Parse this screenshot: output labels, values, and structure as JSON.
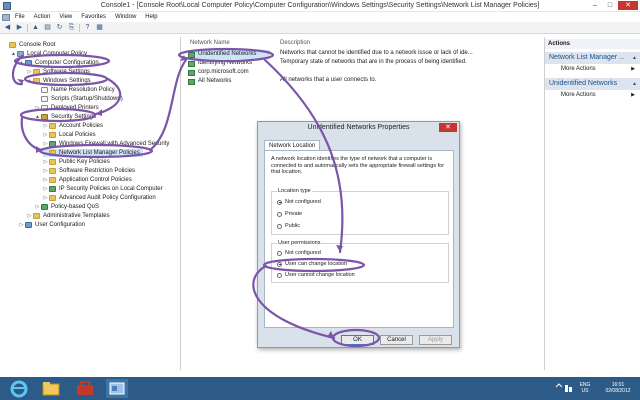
{
  "window": {
    "title": "Console1 - [Console Root\\Local Computer Policy\\Computer Configuration\\Windows Settings\\Security Settings\\Network List Manager Policies]",
    "minimize": "–",
    "maximize": "□",
    "close": "✕"
  },
  "menu": [
    "File",
    "Action",
    "View",
    "Favorites",
    "Window",
    "Help"
  ],
  "toolbar": {
    "back": "◀",
    "forward": "▶",
    "up": "▲",
    "show_hide": "▤",
    "refresh": "↻",
    "export": "⎘",
    "help": "?",
    "properties": "▦"
  },
  "tree": [
    {
      "label": "Console Root",
      "depth": 0,
      "expanded": "",
      "icon": "folder"
    },
    {
      "label": "Local Computer Policy",
      "depth": 1,
      "expanded": "▲",
      "icon": "gear"
    },
    {
      "label": "Computer Configuration",
      "depth": 2,
      "expanded": "▲",
      "icon": "comp"
    },
    {
      "label": "Software Settings",
      "depth": 3,
      "expanded": "▷",
      "icon": "folder"
    },
    {
      "label": "Windows Settings",
      "depth": 3,
      "expanded": "▲",
      "icon": "folder"
    },
    {
      "label": "Name Resolution Policy",
      "depth": 4,
      "expanded": "",
      "icon": "doc"
    },
    {
      "label": "Scripts (Startup/Shutdown)",
      "depth": 4,
      "expanded": "",
      "icon": "doc"
    },
    {
      "label": "Deployed Printers",
      "depth": 4,
      "expanded": "▷",
      "icon": "doc"
    },
    {
      "label": "Security Settings",
      "depth": 4,
      "expanded": "▲",
      "icon": "lock"
    },
    {
      "label": "Account Policies",
      "depth": 5,
      "expanded": "▷",
      "icon": "folder"
    },
    {
      "label": "Local Policies",
      "depth": 5,
      "expanded": "▷",
      "icon": "folder"
    },
    {
      "label": "Windows Firewall with Advanced Security",
      "depth": 5,
      "expanded": "▷",
      "icon": "net"
    },
    {
      "label": "Network List Manager Policies",
      "depth": 5,
      "expanded": "",
      "icon": "folder"
    },
    {
      "label": "Public Key Policies",
      "depth": 5,
      "expanded": "▷",
      "icon": "folder"
    },
    {
      "label": "Software Restriction Policies",
      "depth": 5,
      "expanded": "▷",
      "icon": "folder"
    },
    {
      "label": "Application Control Policies",
      "depth": 5,
      "expanded": "▷",
      "icon": "folder"
    },
    {
      "label": "IP Security Policies on Local Computer",
      "depth": 5,
      "expanded": "▷",
      "icon": "net"
    },
    {
      "label": "Advanced Audit Policy Configuration",
      "depth": 5,
      "expanded": "▷",
      "icon": "folder"
    },
    {
      "label": "Policy-based QoS",
      "depth": 4,
      "expanded": "▷",
      "icon": "net"
    },
    {
      "label": "Administrative Templates",
      "depth": 3,
      "expanded": "▷",
      "icon": "folder"
    },
    {
      "label": "User Configuration",
      "depth": 2,
      "expanded": "▷",
      "icon": "comp"
    }
  ],
  "list": {
    "col_name": "Network Name",
    "col_desc": "Description",
    "rows": [
      {
        "name": "Unidentified Networks",
        "desc": "Networks that cannot be identified due to a network issue or lack of ide..."
      },
      {
        "name": "Identifying Networks",
        "desc": "Temporary state of networks that are in the process of being identified."
      },
      {
        "name": "corp.microsoft.com",
        "desc": ""
      },
      {
        "name": "All Networks",
        "desc": "All networks that a user connects to."
      }
    ]
  },
  "actions": {
    "header": "Actions",
    "sections": [
      {
        "title": "Network List Manager ...",
        "items": [
          "More Actions"
        ]
      },
      {
        "title": "Unidentified Networks",
        "items": [
          "More Actions"
        ]
      }
    ],
    "arrow": "▲",
    "more_arrow": "▶"
  },
  "dialog": {
    "title": "Unidentified Networks Properties",
    "tab": "Network Location",
    "description": "A network location identifies the type of network that a computer is connected to and automatically sets the appropriate firewall settings for that location.",
    "location_type_label": "Location type",
    "location_options": [
      "Not configured",
      "Private",
      "Public"
    ],
    "location_selected": "Not configured",
    "user_permissions_label": "User permissions",
    "permission_options": [
      "Not configured",
      "User can change location",
      "User cannot change location"
    ],
    "permission_selected": "User can change location",
    "ok": "OK",
    "cancel": "Cancel",
    "apply": "Apply"
  },
  "taskbar": {
    "lang_top": "ENG",
    "lang_bottom": "US",
    "time": "16:01",
    "date": "02/08/2012"
  },
  "colors": {
    "annotation": "#7b55a8",
    "taskbar": "#2d5b88",
    "selection": "#cde3f7"
  }
}
